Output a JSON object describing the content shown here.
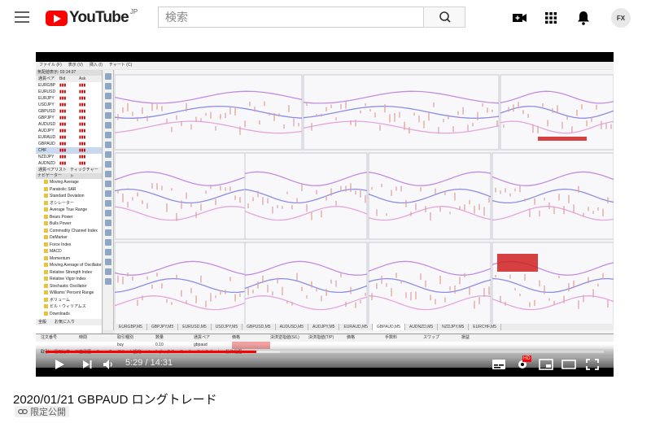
{
  "masthead": {
    "logo_text": "YouTube",
    "region": "JP",
    "search_placeholder": "検索",
    "avatar_text": "FX",
    "icons": [
      "menu-icon",
      "search-icon",
      "video-camera-icon",
      "apps-grid-icon",
      "bell-icon"
    ]
  },
  "player": {
    "current_time": "5:29",
    "separator": "/",
    "duration": "14:31",
    "progress_fraction": 0.378,
    "buffered_fraction": 0.42,
    "controls": [
      "play-icon",
      "next-icon",
      "volume-icon",
      "subtitles-icon",
      "settings-icon",
      "miniplayer-icon",
      "theater-icon",
      "fullscreen-icon"
    ],
    "settings_badge": "HD"
  },
  "mt4": {
    "menu": [
      "ファイル (F)",
      "表示 (V)",
      "挿入 (I)",
      "チャート (C)"
    ],
    "market_watch_title": "気配値表示: 03:14:37",
    "quote_headers": [
      "通貨ペア",
      "Bid",
      "Ask"
    ],
    "quotes": [
      "EURGBP",
      "EURUSD",
      "EURJPY",
      "USDJPY",
      "GBPUSD",
      "GBPJPY",
      "AUDUSD",
      "AUDJPY",
      "EURAUD",
      "GBPAUD",
      "CHF",
      "NZDJPY",
      "AUDNZD"
    ],
    "quote_tabs": [
      "通貨ペアリスト",
      "ティックチャート"
    ],
    "navigator_title": "ナビゲーター",
    "navigator_items": [
      "Moving Average",
      "Parabolic SAR",
      "Standard Deviation",
      "オシレーター",
      "Average True Range",
      "Bears Power",
      "Bulls Power",
      "Commodity Channel Index",
      "DeMarker",
      "Force Index",
      "MACD",
      "Momentum",
      "Moving Average of Oscillator",
      "Relative Strength Index",
      "Relative Vigor Index",
      "Stochastic Oscillator",
      "Williams' Percent Range",
      "ボリューム",
      "ビル・ウィリアムス",
      "Downloads"
    ],
    "nav_tabs": [
      "全般",
      "お気に入り"
    ],
    "chart_tabs": [
      "EURGBP,M5",
      "GBPJPY,M5",
      "EURUSD,M5",
      "USDJPY,M5",
      "GBPUSD,M5",
      "AUDUSD,M5",
      "AUDJPY,M5",
      "EURAUD,M5",
      "GBPAUD,M5",
      "AUDNZD,M5",
      "NZDJPY,M5",
      "EURCHF,M5"
    ],
    "terminal_headers": [
      "注文番号",
      "時間",
      "取引種別",
      "数量",
      "通貨ペア",
      "価格",
      "決済逆指値(S/L)",
      "決済指値(T/P)",
      "価格",
      "手数料",
      "スワップ",
      "損益"
    ],
    "terminal_row": [
      "",
      "",
      "buy",
      "0.10",
      "gbpaud",
      "",
      "",
      "",
      "",
      "",
      "",
      ""
    ],
    "terminal_tabs": [
      "取引",
      "運用比率",
      "口座履歴",
      "ニュース",
      "アラーム設定",
      "メールボックス",
      "コード",
      "エキスパート",
      "操作履歴"
    ]
  },
  "video": {
    "title": "2020/01/21 GBPAUD ロングトレード",
    "privacy_label": "限定公開"
  }
}
